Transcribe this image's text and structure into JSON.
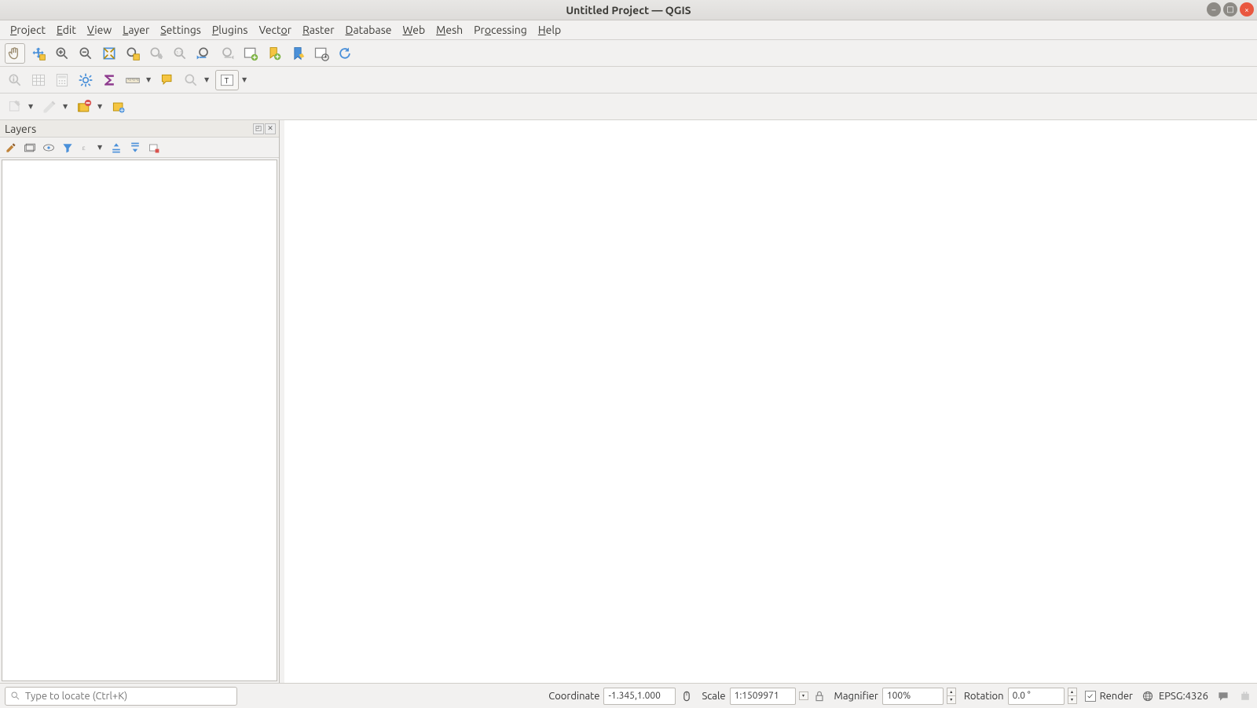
{
  "window": {
    "title": "Untitled Project — QGIS"
  },
  "menu": {
    "items": [
      {
        "label": "Project",
        "u": "P"
      },
      {
        "label": "Edit",
        "u": "E"
      },
      {
        "label": "View",
        "u": "V"
      },
      {
        "label": "Layer",
        "u": "L"
      },
      {
        "label": "Settings",
        "u": "S"
      },
      {
        "label": "Plugins",
        "u": "P"
      },
      {
        "label": "Vector",
        "u": "o"
      },
      {
        "label": "Raster",
        "u": "R"
      },
      {
        "label": "Database",
        "u": "D"
      },
      {
        "label": "Web",
        "u": "W"
      },
      {
        "label": "Mesh",
        "u": "M"
      },
      {
        "label": "Processing",
        "u": "o"
      },
      {
        "label": "Help",
        "u": "H"
      }
    ]
  },
  "panels": {
    "layers": {
      "title": "Layers"
    }
  },
  "statusbar": {
    "locate_placeholder": "Type to locate (Ctrl+K)",
    "coordinate_label": "Coordinate",
    "coordinate_value": "-1.345,1.000",
    "scale_label": "Scale",
    "scale_value": "1:1509971",
    "magnifier_label": "Magnifier",
    "magnifier_value": "100%",
    "rotation_label": "Rotation",
    "rotation_value": "0.0 °",
    "render_label": "Render",
    "render_checked": true,
    "crs_label": "EPSG:4326"
  }
}
